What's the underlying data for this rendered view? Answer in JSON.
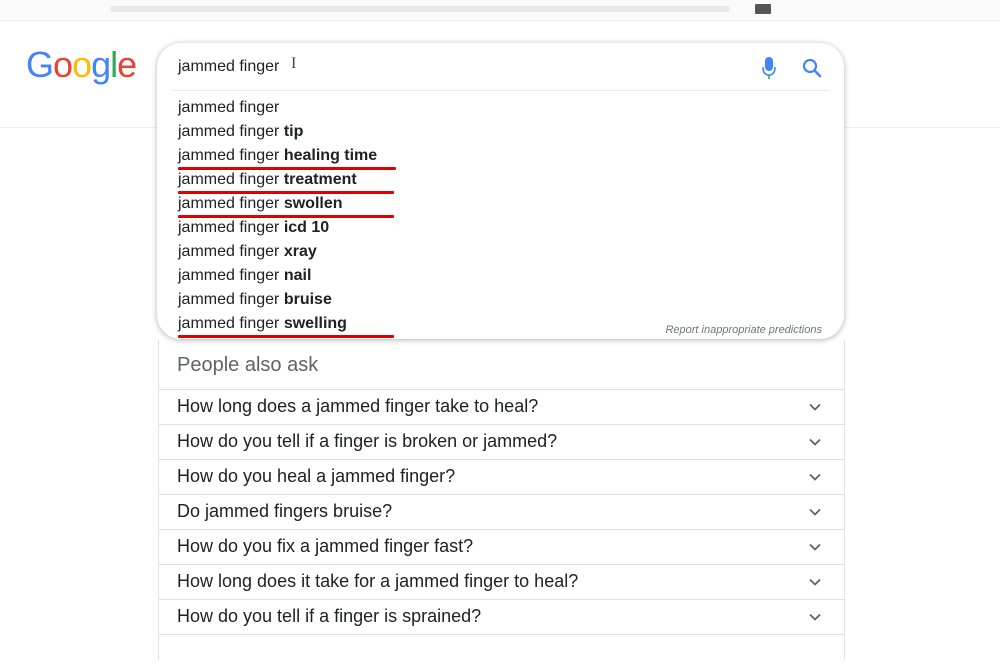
{
  "logo": {
    "letters": [
      "G",
      "o",
      "o",
      "g",
      "l",
      "e"
    ],
    "colors": [
      "#4285F4",
      "#EA4335",
      "#FBBC05",
      "#4285F4",
      "#34A853",
      "#EA4335"
    ]
  },
  "search": {
    "query": "jammed finger",
    "mic_icon": "mic-icon",
    "search_icon": "search-icon"
  },
  "suggestions": [
    {
      "base": "jammed finger",
      "bold": ""
    },
    {
      "base": "jammed finger ",
      "bold": "tip"
    },
    {
      "base": "jammed finger ",
      "bold": "healing time"
    },
    {
      "base": "jammed finger ",
      "bold": "treatment"
    },
    {
      "base": "jammed finger ",
      "bold": "swollen"
    },
    {
      "base": "jammed finger ",
      "bold": "icd 10"
    },
    {
      "base": "jammed finger ",
      "bold": "xray"
    },
    {
      "base": "jammed finger ",
      "bold": "nail"
    },
    {
      "base": "jammed finger ",
      "bold": "bruise"
    },
    {
      "base": "jammed finger ",
      "bold": "swelling"
    }
  ],
  "report_link": "Report inappropriate predictions",
  "people_also_ask": {
    "title": "People also ask",
    "questions": [
      "How long does a jammed finger take to heal?",
      "How do you tell if a finger is broken or jammed?",
      "How do you heal a jammed finger?",
      "Do jammed fingers bruise?",
      "How do you fix a jammed finger fast?",
      "How long does it take for a jammed finger to heal?",
      "How do you tell if a finger is sprained?"
    ]
  },
  "annotation_color": "#e10000"
}
